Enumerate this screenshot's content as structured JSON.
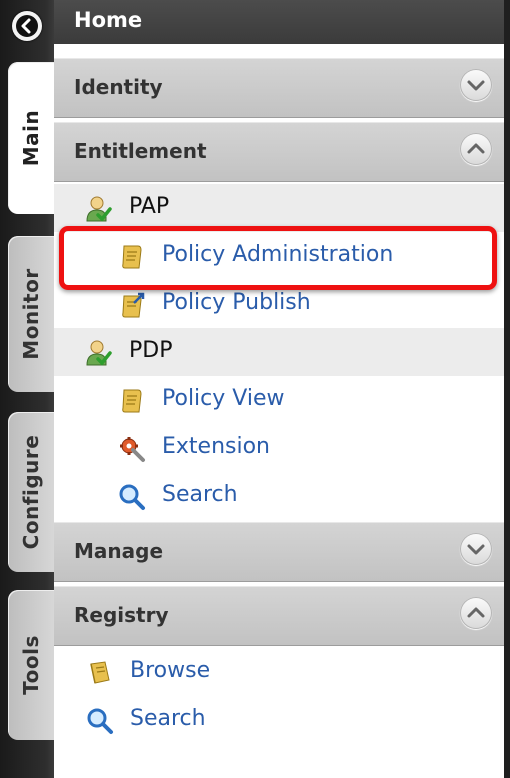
{
  "side_tabs": [
    {
      "label": "Main",
      "active": true
    },
    {
      "label": "Monitor",
      "active": false
    },
    {
      "label": "Configure",
      "active": false
    },
    {
      "label": "Tools",
      "active": false
    }
  ],
  "home": {
    "title": "Home"
  },
  "sections": {
    "identity": {
      "title": "Identity",
      "state": "collapsed"
    },
    "entitlement": {
      "title": "Entitlement",
      "state": "expanded",
      "groups": [
        {
          "label": "PAP",
          "icon": "user-check-icon",
          "items": [
            {
              "label": "Policy Administration",
              "icon": "scroll-icon",
              "highlighted": true
            },
            {
              "label": "Policy Publish",
              "icon": "scroll-publish-icon"
            }
          ]
        },
        {
          "label": "PDP",
          "icon": "user-check-icon",
          "items": [
            {
              "label": "Policy View",
              "icon": "scroll-icon"
            },
            {
              "label": "Extension",
              "icon": "gear-wrench-icon"
            },
            {
              "label": "Search",
              "icon": "magnifier-icon"
            }
          ]
        }
      ]
    },
    "manage": {
      "title": "Manage",
      "state": "collapsed"
    },
    "registry": {
      "title": "Registry",
      "state": "expanded",
      "items": [
        {
          "label": "Browse",
          "icon": "book-icon"
        },
        {
          "label": "Search",
          "icon": "magnifier-icon"
        }
      ]
    }
  },
  "colors": {
    "link": "#2a5caa",
    "highlight": "#ee1111",
    "header_bg": "#444444"
  }
}
